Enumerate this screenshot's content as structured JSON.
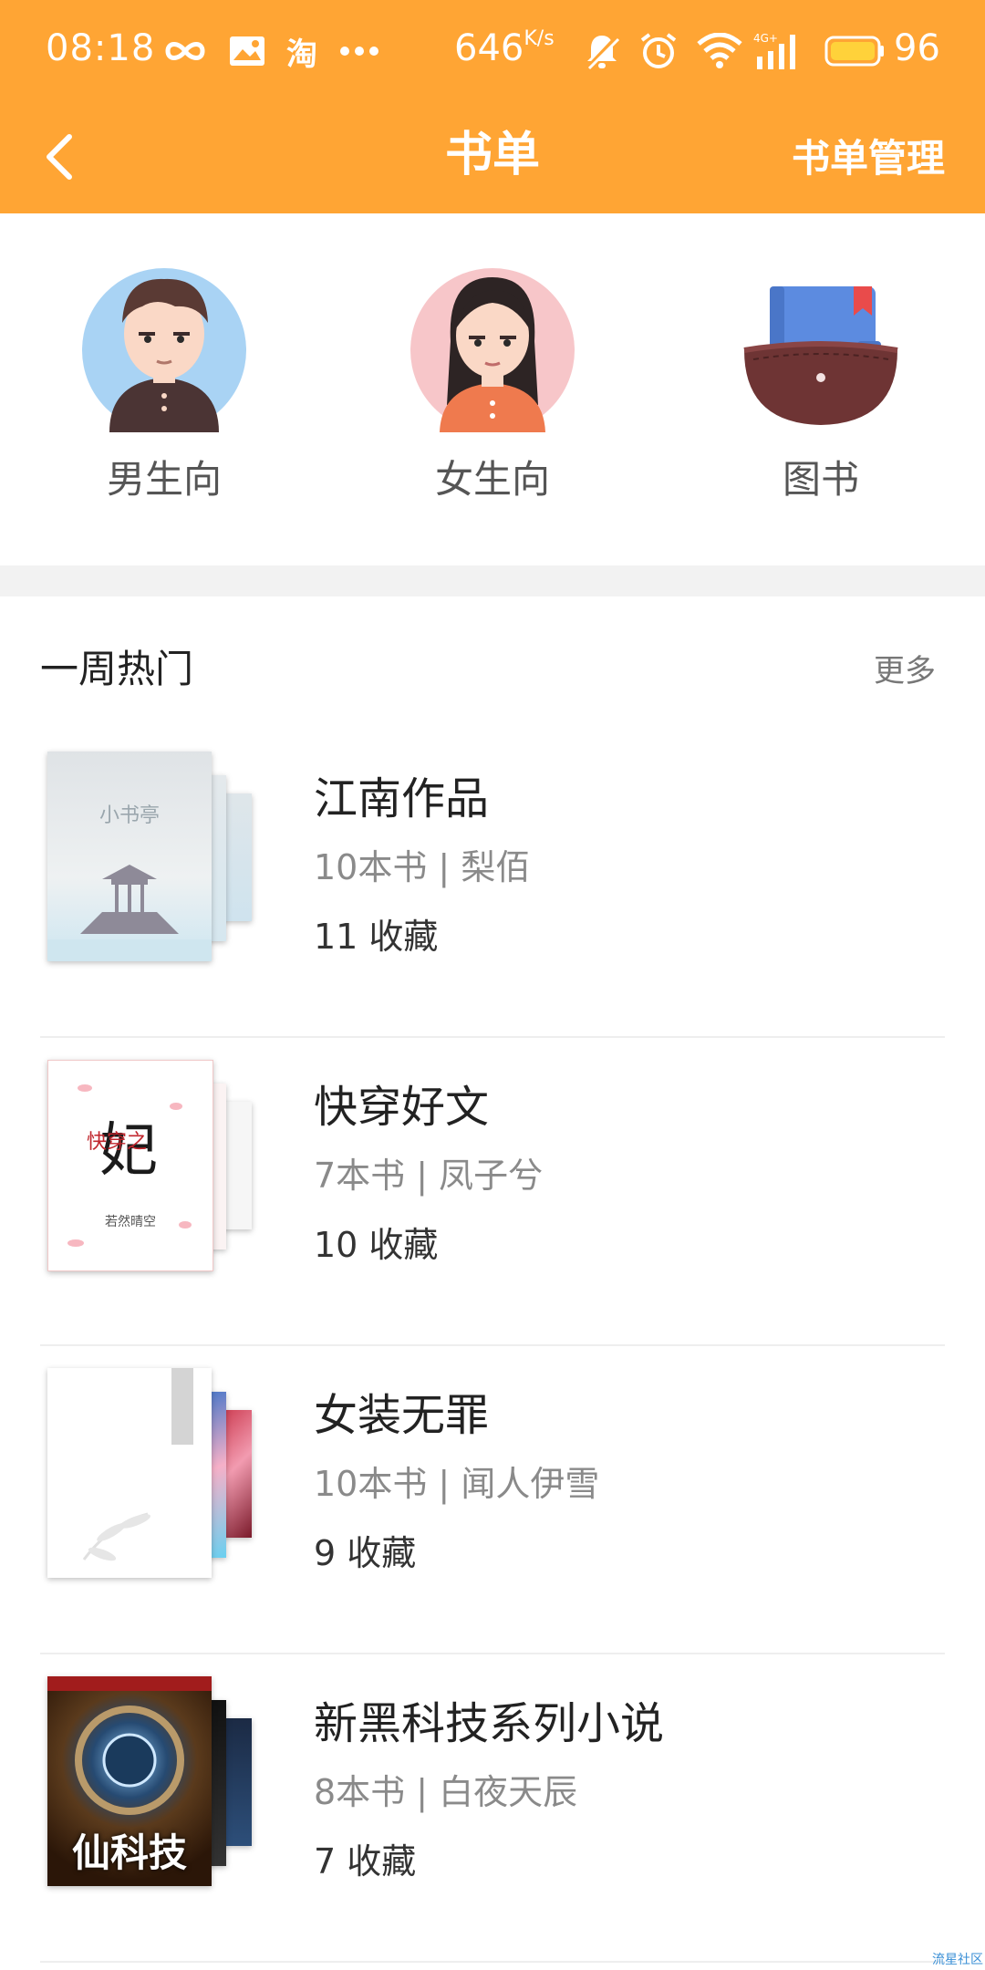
{
  "status_bar": {
    "time": "08:18",
    "speed": "646",
    "speed_unit": "K/s",
    "battery": "96",
    "network": "4G+"
  },
  "nav": {
    "title": "书单",
    "manage": "书单管理"
  },
  "categories": [
    {
      "label": "男生向",
      "icon": "male-avatar-icon"
    },
    {
      "label": "女生向",
      "icon": "female-avatar-icon"
    },
    {
      "label": "图书",
      "icon": "book-pocket-icon"
    }
  ],
  "section": {
    "title": "一周热门",
    "more": "更多"
  },
  "booklists": [
    {
      "name": "江南作品",
      "meta": "10本书 | 梨佰",
      "favorites": "11 收藏",
      "cover_text": "小书亭"
    },
    {
      "name": "快穿好文",
      "meta": "7本书 | 凤子兮",
      "favorites": "10 收藏",
      "cover_text": "若然晴空"
    },
    {
      "name": "女装无罪",
      "meta": "10本书 | 闻人伊雪",
      "favorites": "9 收藏"
    },
    {
      "name": "新黑科技系列小说",
      "meta": "8本书 | 白夜天辰",
      "favorites": "7 收藏",
      "cover_text": "仙科技"
    }
  ],
  "watermark": "流星社区",
  "colors": {
    "accent": "#FFA534",
    "band": "#F2F2F2"
  }
}
